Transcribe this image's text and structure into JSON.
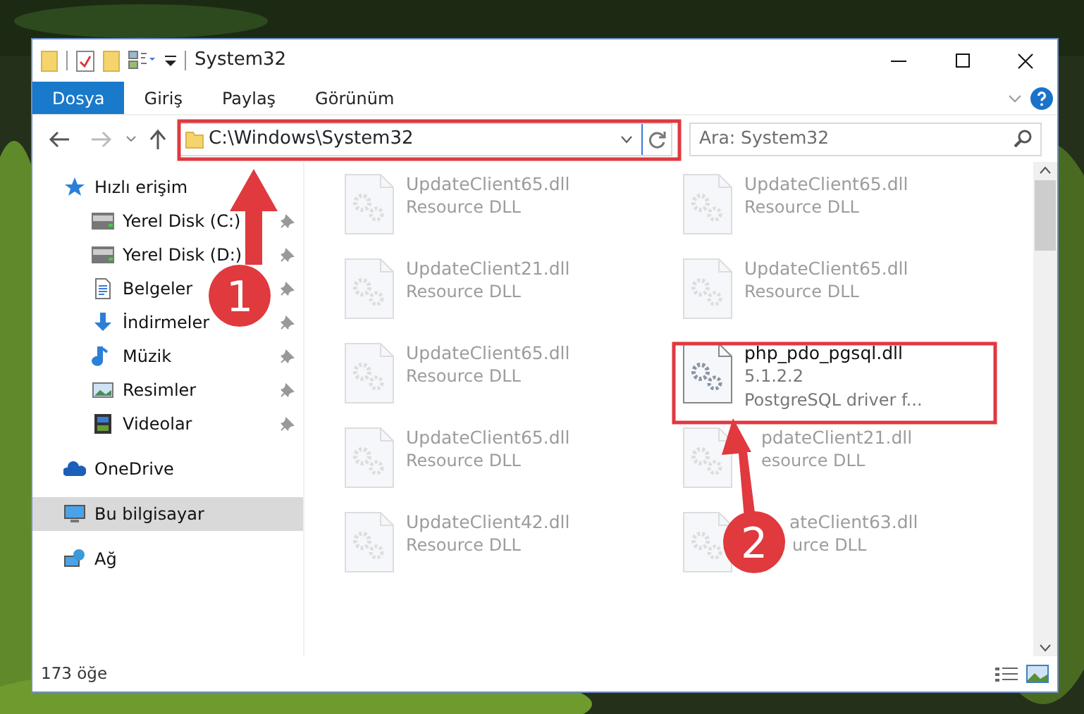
{
  "window": {
    "title": "System32"
  },
  "ribbon_tabs": [
    {
      "label": "Dosya",
      "selected": true
    },
    {
      "label": "Giriş",
      "selected": false
    },
    {
      "label": "Paylaş",
      "selected": false
    },
    {
      "label": "Görünüm",
      "selected": false
    }
  ],
  "address_bar": {
    "path": "C:\\Windows\\System32"
  },
  "search": {
    "placeholder": "Ara: System32"
  },
  "nav_pane": [
    {
      "label": "Hızlı erişim",
      "kind": "star",
      "pinned": false,
      "selected": false,
      "children": [
        {
          "label": "Yerel Disk (C:)",
          "kind": "disk",
          "pinned": true,
          "selected": false
        },
        {
          "label": "Yerel Disk (D:)",
          "kind": "disk",
          "pinned": true,
          "selected": false
        },
        {
          "label": "Belgeler",
          "kind": "doc",
          "pinned": true,
          "selected": false
        },
        {
          "label": "İndirmeler",
          "kind": "download",
          "pinned": true,
          "selected": false
        },
        {
          "label": "Müzik",
          "kind": "music",
          "pinned": true,
          "selected": false
        },
        {
          "label": "Resimler",
          "kind": "pictures",
          "pinned": true,
          "selected": false
        },
        {
          "label": "Videolar",
          "kind": "video",
          "pinned": true,
          "selected": false
        }
      ]
    },
    {
      "label": "OneDrive",
      "kind": "cloud",
      "pinned": false,
      "selected": false
    },
    {
      "label": "Bu bilgisayar",
      "kind": "pc",
      "pinned": false,
      "selected": true
    },
    {
      "label": "Ağ",
      "kind": "network",
      "pinned": false,
      "selected": false
    }
  ],
  "files": [
    {
      "name": "UpdateClient65.dll",
      "details": [
        "Resource DLL"
      ],
      "blurred": true
    },
    {
      "name": "UpdateClient65.dll",
      "details": [
        "Resource DLL"
      ],
      "blurred": true
    },
    {
      "name": "UpdateClient21.dll",
      "details": [
        "Resource DLL"
      ],
      "blurred": true
    },
    {
      "name": "UpdateClient65.dll",
      "details": [
        "Resource DLL"
      ],
      "blurred": true
    },
    {
      "name": "UpdateClient65.dll",
      "details": [
        "Resource DLL"
      ],
      "blurred": true
    },
    {
      "name": "php_pdo_pgsql.dll",
      "details": [
        "5.1.2.2",
        "PostgreSQL driver f..."
      ],
      "blurred": false
    },
    {
      "name": "UpdateClient65.dll",
      "details": [
        "Resource DLL"
      ],
      "blurred": true
    },
    {
      "name": "pdateClient21.dll",
      "details": [
        "esource DLL"
      ],
      "blurred": true,
      "kind": "covered"
    },
    {
      "name": "UpdateClient42.dll",
      "details": [
        "Resource DLL"
      ],
      "blurred": true
    },
    {
      "name": "ateClient63.dll",
      "details": [
        "urce DLL"
      ],
      "blurred": true,
      "kind": "covered"
    }
  ],
  "status_bar": {
    "item_count": "173 öğe"
  },
  "annotations": [
    {
      "label": "1"
    },
    {
      "label": "2"
    }
  ]
}
